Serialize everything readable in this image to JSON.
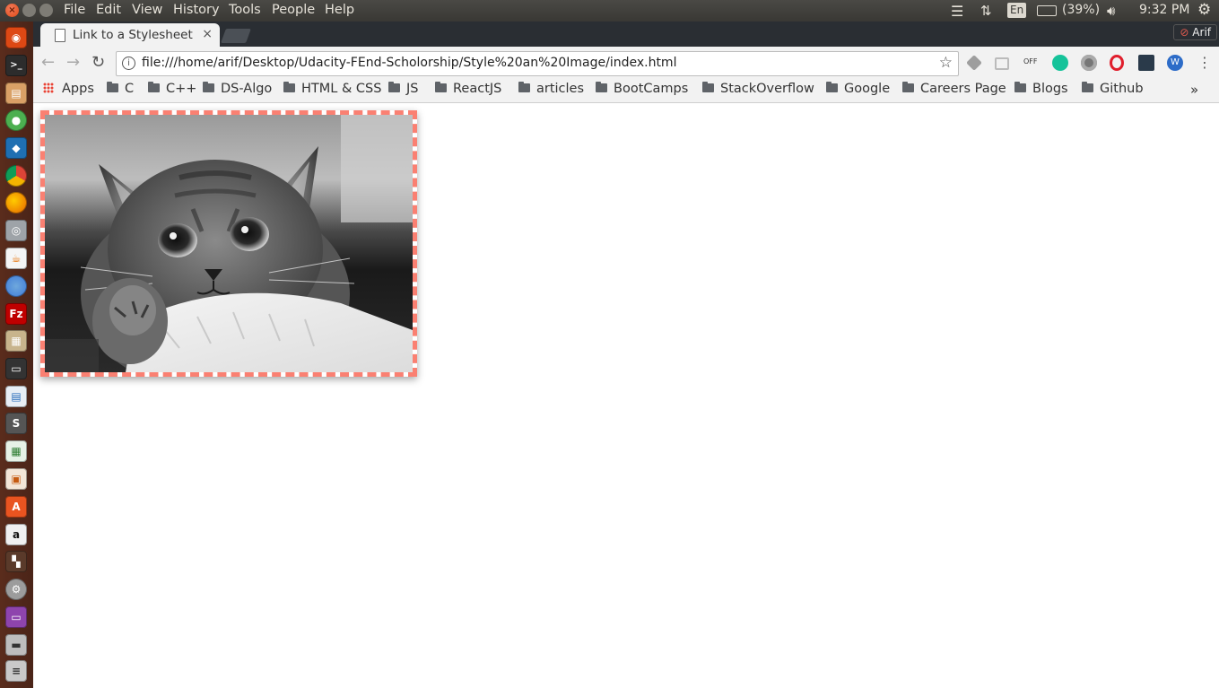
{
  "system_bar": {
    "menu": [
      "File",
      "Edit",
      "View",
      "History",
      "Tools",
      "People",
      "Help"
    ],
    "keyboard": "En",
    "battery": "(39%)",
    "time": "9:32 PM"
  },
  "browser": {
    "tab_title": "Link to a Stylesheet",
    "tab_close": "×",
    "profile_name": "Arif",
    "url": "file:///home/arif/Desktop/Udacity-FEnd-Scholorship/Style%20an%20Image/index.html",
    "bookmarks": [
      "Apps",
      "C",
      "C++",
      "DS-Algo",
      "HTML & CSS",
      "JS",
      "ReactJS",
      "articles",
      "BootCamps",
      "StackOverflow",
      "Google",
      "Careers Page",
      "Blogs",
      "Github"
    ],
    "overflow": "»"
  },
  "page": {
    "image": "kitten-photo",
    "border_color": "#fa8072"
  }
}
